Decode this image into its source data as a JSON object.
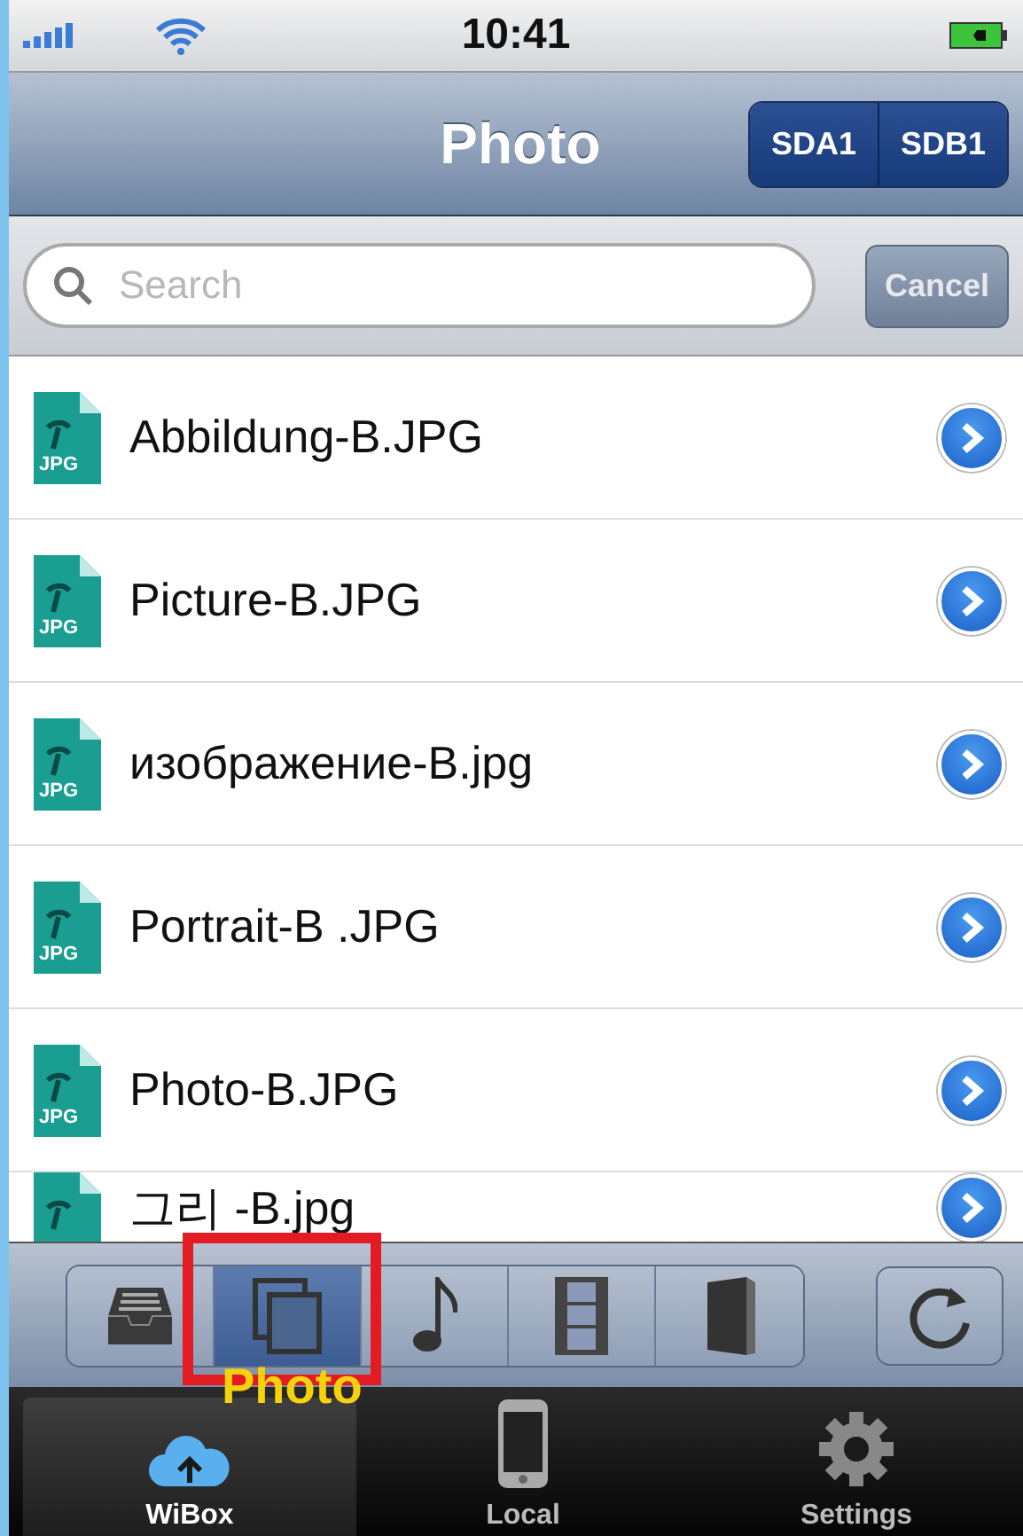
{
  "status_bar": {
    "time": "10:41"
  },
  "nav_bar": {
    "title": "Photo",
    "segments": [
      {
        "label": "SDA1"
      },
      {
        "label": "SDB1"
      }
    ]
  },
  "search": {
    "placeholder": "Search",
    "cancel": "Cancel"
  },
  "files": [
    {
      "name": "Abbildung-B.JPG",
      "icon_label": "JPG"
    },
    {
      "name": "Picture-B.JPG",
      "icon_label": "JPG"
    },
    {
      "name": "изображение-B.jpg",
      "icon_label": "JPG"
    },
    {
      "name": "Portrait-B .JPG",
      "icon_label": "JPG"
    },
    {
      "name": "Photo-B.JPG",
      "icon_label": "JPG"
    },
    {
      "name": "그리 -B.jpg"
    }
  ],
  "media_toolbar": [
    {
      "kind": "tray",
      "selected": false
    },
    {
      "kind": "photo",
      "selected": true
    },
    {
      "kind": "music",
      "selected": false
    },
    {
      "kind": "film",
      "selected": false
    },
    {
      "kind": "book",
      "selected": false
    }
  ],
  "annotation": {
    "label": "Photo"
  },
  "tab_bar": [
    {
      "kind": "cloud",
      "label": "WiBox",
      "selected": true
    },
    {
      "kind": "phone",
      "label": "Local",
      "selected": false
    },
    {
      "kind": "gear",
      "label": "Settings",
      "selected": false
    }
  ]
}
